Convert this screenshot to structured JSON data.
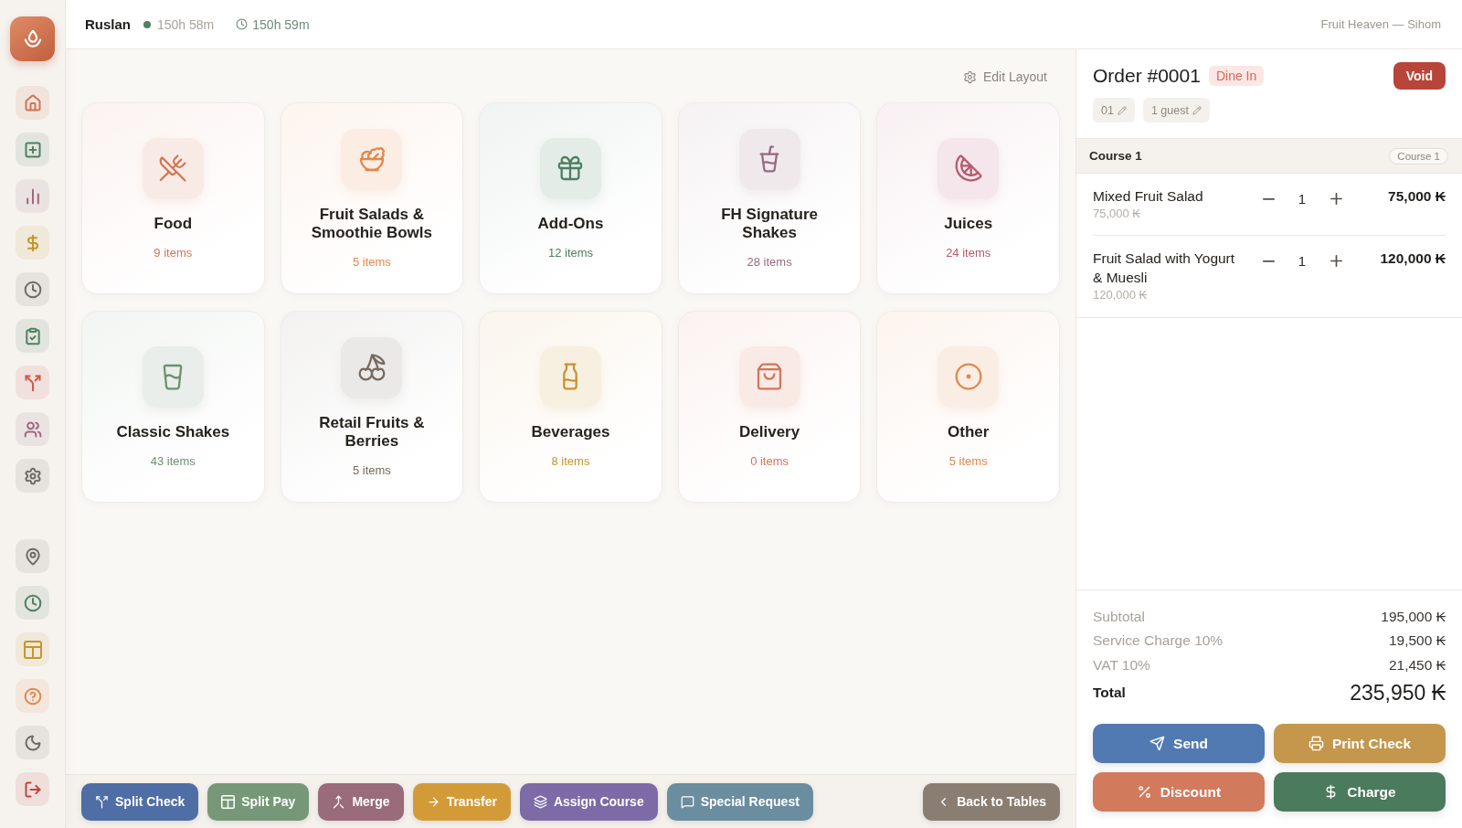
{
  "sidebar": {
    "top_items": [
      {
        "color": "#cf7556"
      },
      {
        "color": "#4e8062"
      },
      {
        "color": "#9a6a80"
      },
      {
        "color": "#c7952f"
      },
      {
        "color": "#6f6a65"
      },
      {
        "color": "#4e8062"
      },
      {
        "color": "#d0574a"
      },
      {
        "color": "#9a6a80"
      },
      {
        "color": "#6f6a65"
      }
    ],
    "bottom_items": [
      {
        "color": "#6f6a65"
      },
      {
        "color": "#4e8062"
      },
      {
        "color": "#c7952f"
      },
      {
        "color": "#e0894f"
      },
      {
        "color": "#6f6a65"
      },
      {
        "color": "#c0443c"
      }
    ]
  },
  "top_bar": {
    "user": "Ruslan",
    "session_time": "150h 58m",
    "clock_time": "150h 59m",
    "store": "Fruit Heaven — Sihom"
  },
  "main": {
    "edit_layout": "Edit Layout",
    "categories": [
      {
        "name": "Food",
        "count": "9 items",
        "color": "#d2775a"
      },
      {
        "name": "Fruit Salads & Smoothie Bowls",
        "count": "5 items",
        "color": "#e2884c"
      },
      {
        "name": "Add-Ons",
        "count": "12 items",
        "color": "#4e7e62"
      },
      {
        "name": "FH Signature Shakes",
        "count": "28 items",
        "color": "#956b80"
      },
      {
        "name": "Juices",
        "count": "24 items",
        "color": "#b65a70"
      },
      {
        "name": "Classic Shakes",
        "count": "43 items",
        "color": "#6e8f72"
      },
      {
        "name": "Retail Fruits & Berries",
        "count": "5 items",
        "color": "#75695f"
      },
      {
        "name": "Beverages",
        "count": "8 items",
        "color": "#c8922e"
      },
      {
        "name": "Delivery",
        "count": "0 items",
        "color": "#d4745a"
      },
      {
        "name": "Other",
        "count": "5 items",
        "color": "#e0874c"
      }
    ]
  },
  "toolbar": {
    "actions": [
      {
        "label": "Split Check",
        "color": "#4f6ea6"
      },
      {
        "label": "Split Pay",
        "color": "#779878"
      },
      {
        "label": "Merge",
        "color": "#9a6b7b"
      },
      {
        "label": "Transfer",
        "color": "#d39b38"
      },
      {
        "label": "Assign Course",
        "color": "#7c6ba6"
      },
      {
        "label": "Special Request",
        "color": "#6a8d9f"
      }
    ],
    "back": "Back to Tables"
  },
  "order": {
    "title": "Order #0001",
    "type": "Dine In",
    "void": "Void",
    "tags": [
      "01",
      "1 guest"
    ],
    "course": {
      "label": "Course 1",
      "badge": "Course 1"
    },
    "items": [
      {
        "name": "Mixed Fruit Salad",
        "unit_price": "75,000 ₭",
        "quantity": "1",
        "total": "75,000 ₭"
      },
      {
        "name": "Fruit Salad with Yogurt & Muesli",
        "unit_price": "120,000 ₭",
        "quantity": "1",
        "total": "120,000 ₭"
      }
    ],
    "summary": [
      {
        "label": "Subtotal",
        "value": "195,000 ₭"
      },
      {
        "label": "Service Charge 10%",
        "value": "19,500 ₭"
      },
      {
        "label": "VAT 10%",
        "value": "21,450 ₭"
      }
    ],
    "total": {
      "label": "Total",
      "value": "235,950 ₭"
    },
    "actions": [
      {
        "label": "Send",
        "color": "#517ab2"
      },
      {
        "label": "Print Check",
        "color": "#c4974c"
      },
      {
        "label": "Discount",
        "color": "#d27a5c"
      },
      {
        "label": "Charge",
        "color": "#4a7b5c"
      }
    ]
  }
}
